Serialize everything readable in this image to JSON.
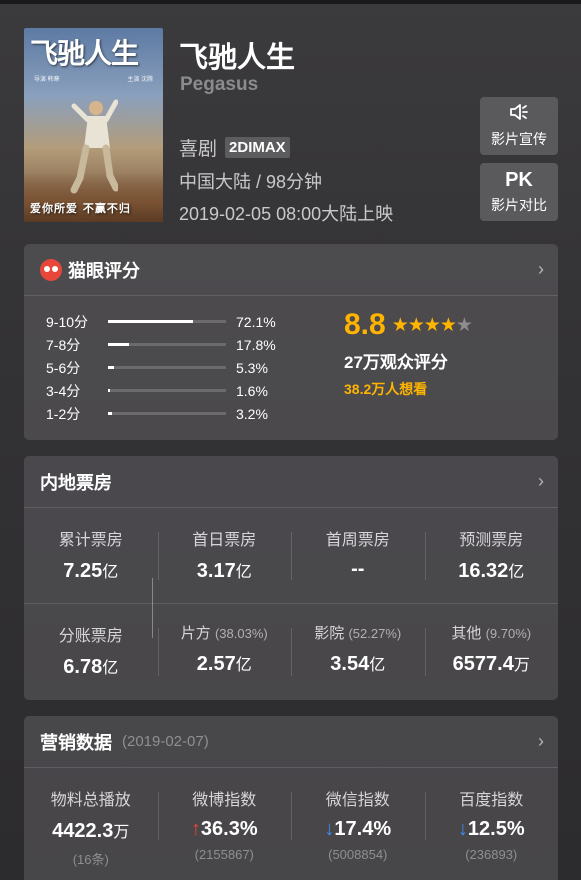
{
  "movie": {
    "title": "飞驰人生",
    "english_title": "Pegasus",
    "genre": "喜剧",
    "format": "2DIMAX",
    "region_duration": "中国大陆 / 98分钟",
    "release": "2019-02-05 08:00大陆上映",
    "poster": {
      "title": "飞驰人生",
      "tagline": "爱你所爱 不赢不归",
      "credit_left": "导演 韩寒",
      "credit_right": "主演 沈腾"
    }
  },
  "actions": {
    "promo": {
      "icon": "speaker-icon",
      "label": "影片宣传"
    },
    "pk": {
      "icon_text": "PK",
      "label": "影片对比"
    }
  },
  "rating": {
    "title": "猫眼评分",
    "chevron": "›",
    "distribution": [
      {
        "label": "9-10分",
        "pct_text": "72.1%",
        "pct": 72.1
      },
      {
        "label": "7-8分",
        "pct_text": "17.8%",
        "pct": 17.8
      },
      {
        "label": "5-6分",
        "pct_text": "5.3%",
        "pct": 5.3
      },
      {
        "label": "3-4分",
        "pct_text": "1.6%",
        "pct": 1.6
      },
      {
        "label": "1-2分",
        "pct_text": "3.2%",
        "pct": 3.2
      }
    ],
    "score": "8.8",
    "stars": "★★★★★",
    "star_rating": 4.5,
    "voters": "27万观众评分",
    "wish": "38.2万人想看",
    "colors": {
      "accent": "#ffb400",
      "brand_red": "#e8463a"
    }
  },
  "boxoffice": {
    "title": "内地票房",
    "chevron": "›",
    "row1": [
      {
        "label": "累计票房",
        "value": "7.25",
        "unit": "亿"
      },
      {
        "label": "首日票房",
        "value": "3.17",
        "unit": "亿"
      },
      {
        "label": "首周票房",
        "value": "--",
        "unit": ""
      },
      {
        "label": "预测票房",
        "value": "16.32",
        "unit": "亿"
      }
    ],
    "row2": [
      {
        "label": "分账票房",
        "pct": "",
        "value": "6.78",
        "unit": "亿"
      },
      {
        "label": "片方",
        "pct": "(38.03%)",
        "value": "2.57",
        "unit": "亿"
      },
      {
        "label": "影院",
        "pct": "(52.27%)",
        "value": "3.54",
        "unit": "亿"
      },
      {
        "label": "其他",
        "pct": "(9.70%)",
        "value": "6577.4",
        "unit": "万"
      }
    ]
  },
  "marketing": {
    "title": "营销数据",
    "date": "(2019-02-07)",
    "chevron": "›",
    "items": [
      {
        "label": "物料总播放",
        "arrow": "",
        "value": "4422.3",
        "unit": "万",
        "sub": "(16条)"
      },
      {
        "label": "微博指数",
        "arrow": "↑",
        "value": "36.3%",
        "unit": "",
        "sub": "(2155867)"
      },
      {
        "label": "微信指数",
        "arrow": "↓",
        "value": "17.4%",
        "unit": "",
        "sub": "(5008854)"
      },
      {
        "label": "百度指数",
        "arrow": "↓",
        "value": "12.5%",
        "unit": "",
        "sub": "(236893)"
      }
    ]
  }
}
